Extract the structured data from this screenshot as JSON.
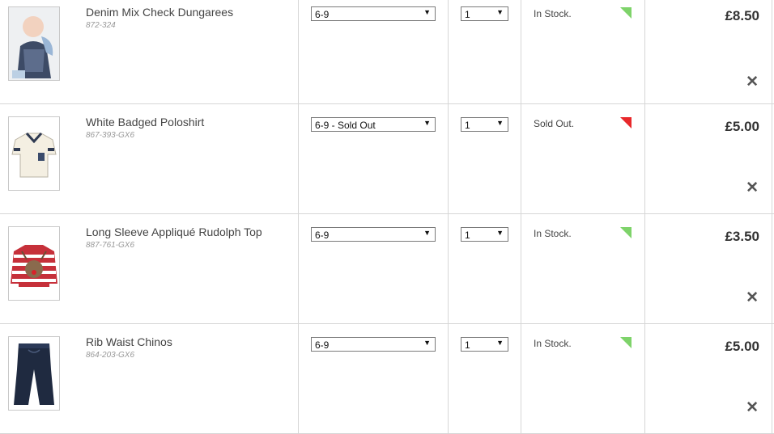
{
  "items": [
    {
      "title": "Denim Mix Check Dungarees",
      "code": "872-324",
      "size": "6-9",
      "qty": "1",
      "stock": "In Stock.",
      "stock_color": "#7ed36a",
      "price": "£8.50",
      "remove_icon": "close-icon"
    },
    {
      "title": "White Badged Poloshirt",
      "code": "867-393-GX6",
      "size": "6-9 - Sold Out",
      "qty": "1",
      "stock": "Sold Out.",
      "stock_color": "#e8282b",
      "price": "£5.00",
      "remove_icon": "close-icon"
    },
    {
      "title": "Long Sleeve Appliqué Rudolph Top",
      "code": "887-761-GX6",
      "size": "6-9",
      "qty": "1",
      "stock": "In Stock.",
      "stock_color": "#7ed36a",
      "price": "£3.50",
      "remove_icon": "close-icon"
    },
    {
      "title": "Rib Waist Chinos",
      "code": "864-203-GX6",
      "size": "6-9",
      "qty": "1",
      "stock": "In Stock.",
      "stock_color": "#7ed36a",
      "price": "£5.00",
      "remove_icon": "close-icon"
    }
  ]
}
